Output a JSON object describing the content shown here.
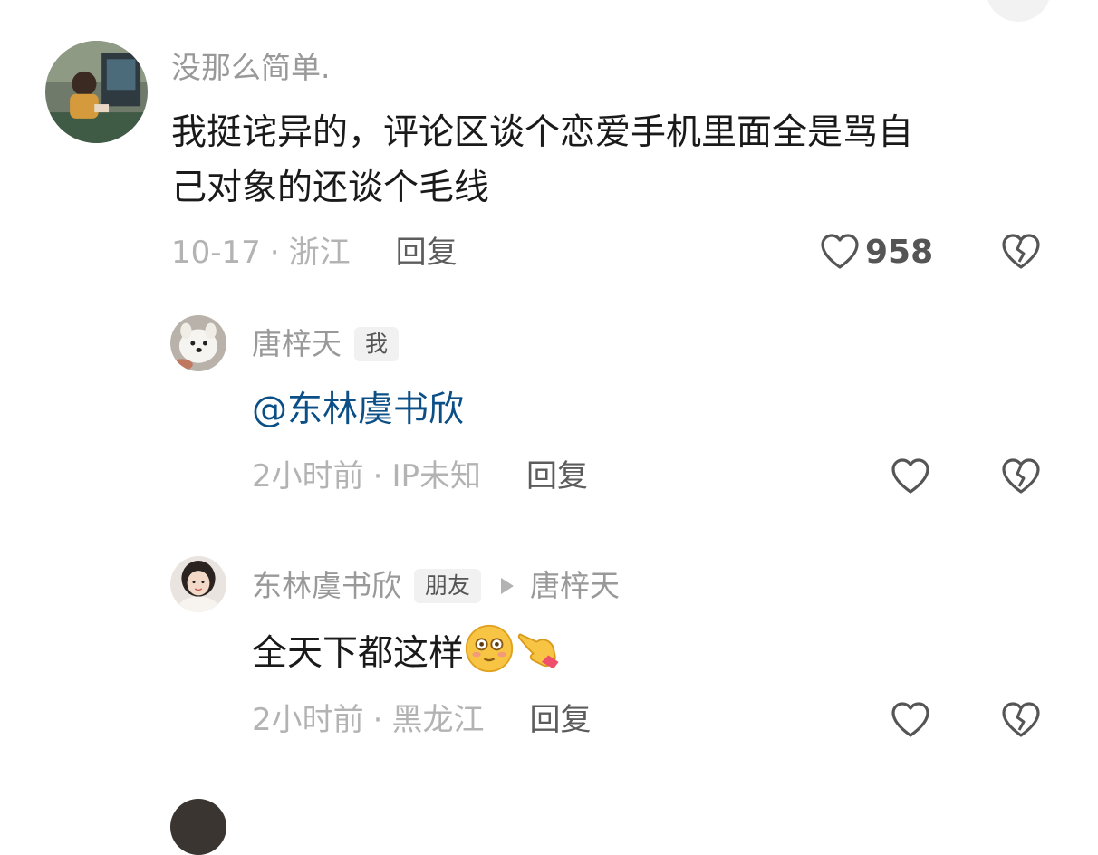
{
  "comments": [
    {
      "username": "没那么简单.",
      "text": "我挺诧异的，评论区谈个恋爱手机里面全是骂自",
      "text_line2": "己对象的还谈个毛线",
      "date": "10-17",
      "location": "浙江",
      "reply_label": "回复",
      "like_count": "958",
      "avatar_icon": "anime-boy-gaming-avatar"
    },
    {
      "username": "唐梓天",
      "tag": "我",
      "mention": "@东林虞书欣",
      "date": "2小时前",
      "location": "IP未知",
      "reply_label": "回复",
      "avatar_icon": "samoyed-dog-avatar"
    },
    {
      "username": "东林虞书欣",
      "tag": "朋友",
      "reply_to": "唐梓天",
      "text": "全天下都这样",
      "emojis": [
        "blushing-smiley-emoji",
        "pointing-hand-emoji"
      ],
      "date": "2小时前",
      "location": "黑龙江",
      "reply_label": "回复",
      "avatar_icon": "girl-photo-avatar"
    }
  ],
  "separator": "·",
  "colors": {
    "username": "#999999",
    "content": "#1a1a1a",
    "mention": "#0b4f86",
    "meta": "#b3b3b3",
    "reply": "#5c5c5c"
  }
}
